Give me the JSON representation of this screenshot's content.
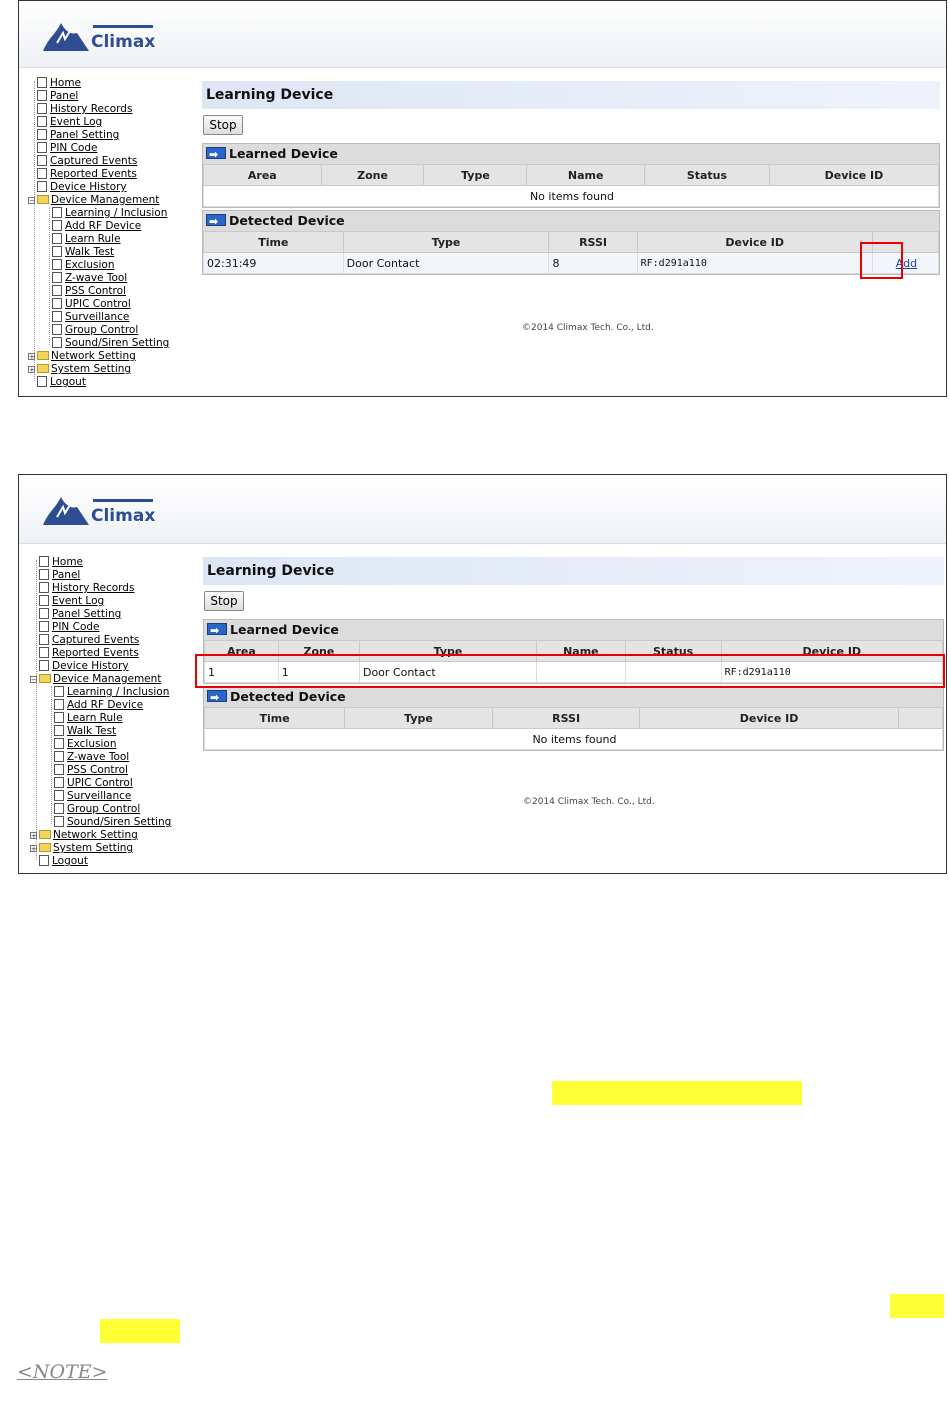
{
  "brand": {
    "logo_text": "Climax"
  },
  "nav": {
    "items": [
      "Home",
      "Panel",
      "History Records",
      "Event Log",
      "Panel Setting",
      "PIN Code",
      "Captured Events",
      "Reported Events",
      "Device History",
      "Device Management"
    ],
    "sub_items": [
      "Learning / Inclusion",
      "Add RF Device",
      "Learn Rule",
      "Walk Test",
      "Exclusion",
      "Z-wave Tool",
      "PSS Control",
      "UPIC Control",
      "Surveillance",
      "Group Control",
      "Sound/Siren Setting"
    ],
    "bottom_items": [
      "Network Setting",
      "System Setting",
      "Logout"
    ]
  },
  "page_title": "Learning Device",
  "stop_label": "Stop",
  "learned": {
    "title": "Learned Device",
    "columns": [
      "Area",
      "Zone",
      "Type",
      "Name",
      "Status",
      "Device ID"
    ],
    "empty_text": "No items found",
    "row": [
      "1",
      "1",
      "Door Contact",
      "",
      "",
      "RF:d291a110"
    ]
  },
  "detected": {
    "title": "Detected Device",
    "columns": [
      "Time",
      "Type",
      "RSSI",
      "Device ID",
      ""
    ],
    "row": [
      "02:31:49",
      "Door Contact",
      "8",
      "RF:d291a110"
    ],
    "add_label": "Add",
    "empty_text": "No items found"
  },
  "footer": "©2014 Climax Tech. Co., Ltd.",
  "note": "<NOTE>",
  "colors": {
    "highlight": "#ffff33",
    "callout": "#e00000",
    "title_bg": "#dde6f5"
  }
}
